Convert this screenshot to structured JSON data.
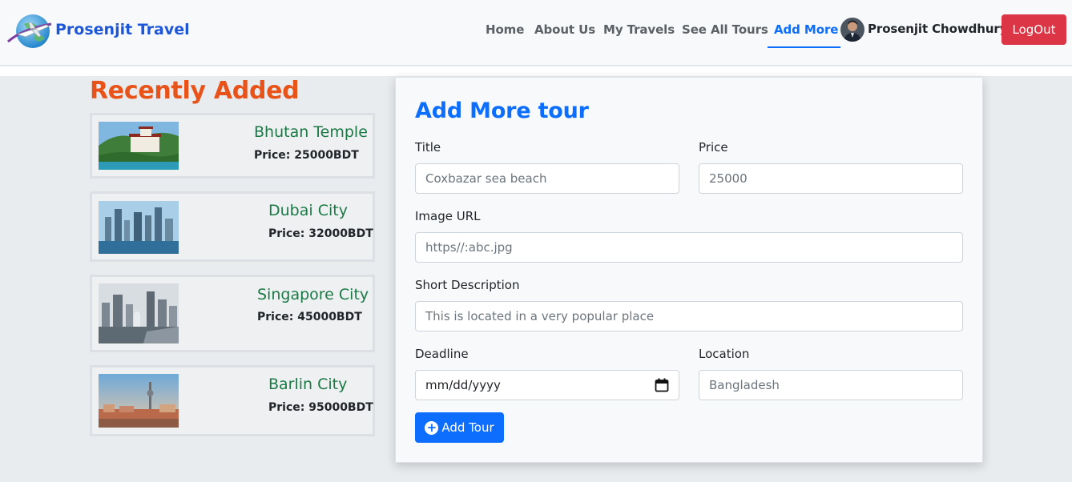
{
  "brand": {
    "name": "Prosenjit Travel",
    "logo_icon": "airplane-globe-icon"
  },
  "nav": {
    "links": [
      "Home",
      "About Us",
      "My Travels",
      "See All Tours",
      "Add More"
    ],
    "active": "Add More",
    "user_name": "Prosenjit Chowdhury",
    "logout_label": "LogOut"
  },
  "recent": {
    "title": "Recently Added",
    "tours": [
      {
        "name": "Bhutan Temple",
        "price": "Price: 25000BDT"
      },
      {
        "name": "Dubai City",
        "price": "Price: 32000BDT"
      },
      {
        "name": "Singapore City",
        "price": "Price: 45000BDT"
      },
      {
        "name": "Barlin City",
        "price": "Price: 95000BDT"
      }
    ]
  },
  "form": {
    "title": "Add More tour",
    "title_label": "Title",
    "title_placeholder": "Coxbazar sea beach",
    "price_label": "Price",
    "price_placeholder": "25000",
    "image_label": "Image URL",
    "image_placeholder": "https//:abc.jpg",
    "desc_label": "Short Description",
    "desc_placeholder": "This is located in a very popular place",
    "deadline_label": "Deadline",
    "deadline_placeholder": "mm/dd/yyyy",
    "location_label": "Location",
    "location_placeholder": "Bangladesh",
    "submit_label": "Add Tour"
  },
  "colors": {
    "brand": "#1d57d8",
    "primary": "#0d6efd",
    "danger": "#dc3545",
    "heading_orange": "#e8531a",
    "tour_green": "#1a7a45"
  }
}
